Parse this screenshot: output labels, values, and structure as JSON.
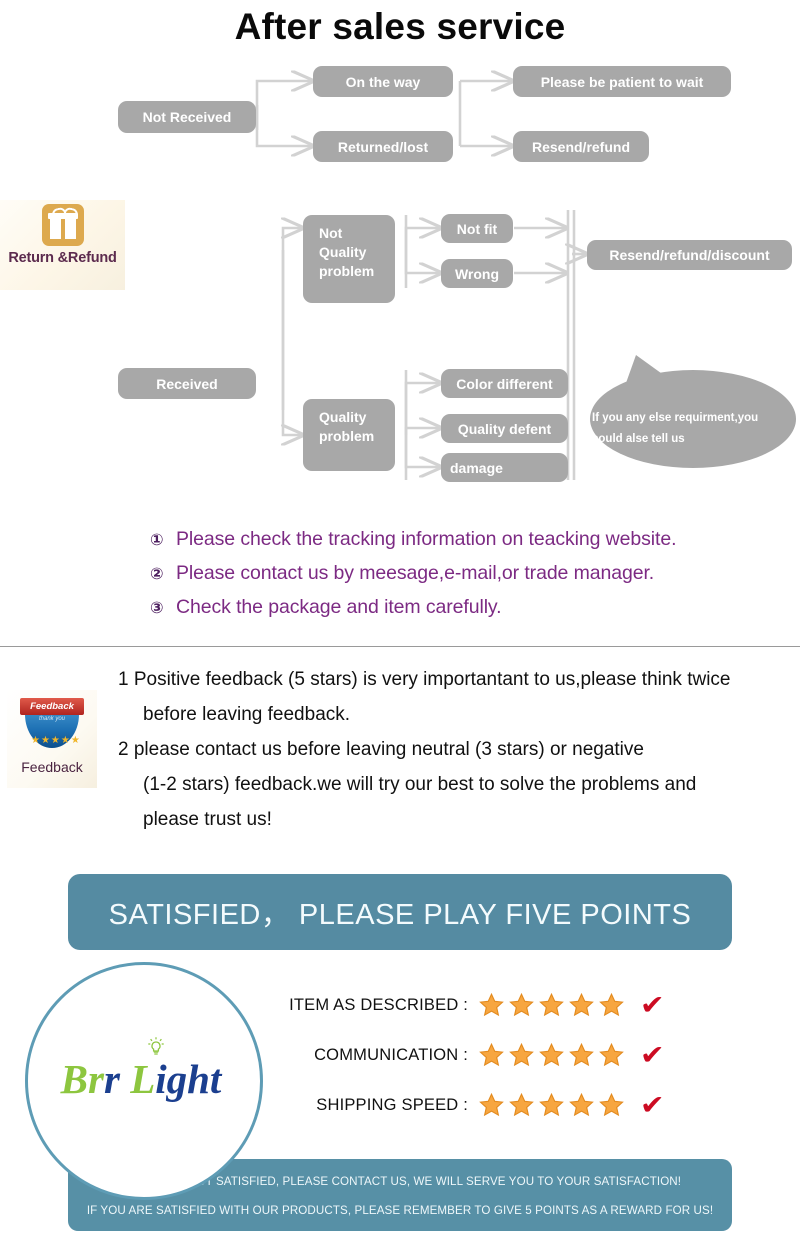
{
  "header": {
    "title": "After sales service"
  },
  "flowchart": {
    "not_received": "Not Received",
    "on_the_way": "On the way",
    "returned_lost": "Returned/lost",
    "please_wait": "Please be patient to wait",
    "resend_refund": "Resend/refund",
    "gift": {
      "label": "Return &Refund",
      "icon": "gift-icon"
    },
    "received": "Received",
    "not_quality_problem": "Not\nQuality\nproblem",
    "quality_problem": "Quality\nproblem",
    "not_fit": "Not fit",
    "wrong": "Wrong",
    "color_different": "Color different",
    "quality_defent": "Quality defent",
    "damage": "damage",
    "resend_refund_discount": "Resend/refund/discount",
    "bubble_line1": "If you any else  requirment,you",
    "bubble_line2": "could alse tell us"
  },
  "instructions": [
    {
      "num": "①",
      "text": "Please check the tracking information on teacking website."
    },
    {
      "num": "②",
      "text": "Please contact us by meesage,e-mail,or trade manager."
    },
    {
      "num": "③",
      "text": "Check the package and item carefully."
    }
  ],
  "feedback": {
    "badge_banner": "Feedback",
    "badge_sub": "thank you",
    "badge_stars": "★★★★★",
    "badge_label": "Feedback",
    "line1": "1 Positive feedback (5 stars) is very importantant to us,please think twice",
    "line2": "before leaving feedback.",
    "line3": "2 please contact us before leaving neutral (3 stars) or negative",
    "line4": "(1-2 stars) feedback.we will try our best to solve the problems and",
    "line5": "please trust us!"
  },
  "banner": {
    "text": "SATISFIED， PLEASE PLAY FIVE POINTS"
  },
  "ratings": {
    "rows": [
      {
        "label": "ITEM AS DESCRIBED :",
        "stars": 5,
        "check": "✔"
      },
      {
        "label": "COMMUNICATION :",
        "stars": 5,
        "check": "✔"
      },
      {
        "label": "SHIPPING SPEED :",
        "stars": 5,
        "check": "✔"
      }
    ]
  },
  "logo": {
    "part1": "Br",
    "part2": "L",
    "part3": "ight",
    "icon": "lightbulb-icon"
  },
  "bottom_banner": {
    "line1": "IF YOU ARE NOT SATISFIED, PLEASE CONTACT US, WE WILL SERVE YOU TO YOUR SATISFACTION!",
    "line2": "IF YOU ARE SATISFIED WITH OUR PRODUCTS, PLEASE REMEMBER TO GIVE 5 POINTS AS A REWARD FOR US!"
  },
  "colors": {
    "node_gray": "#a8a8a8",
    "banner_blue": "#558ba2",
    "purple": "#7c2a83",
    "star_orange": "#f5a623",
    "check_red": "#cc0b22",
    "logo_green": "#8dc63f",
    "logo_blue": "#1b3f8f"
  }
}
